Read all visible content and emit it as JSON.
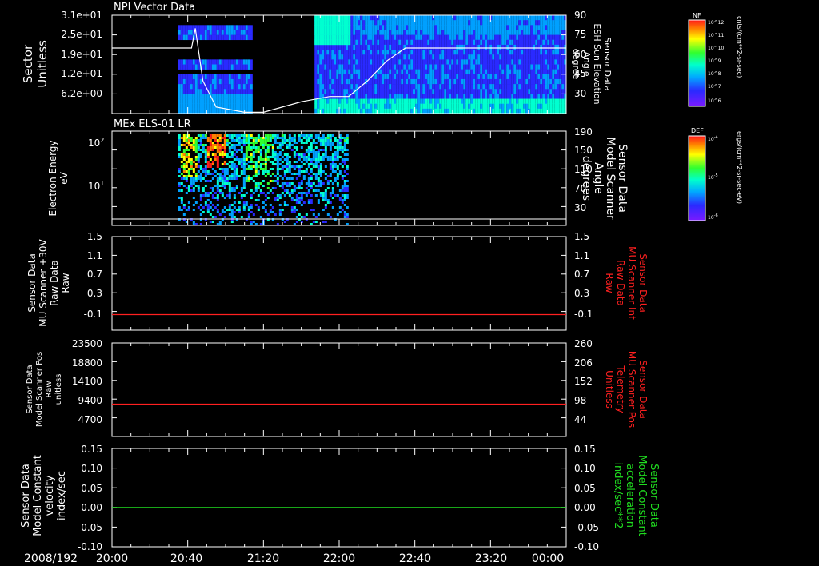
{
  "chart_data": [
    {
      "type": "heatmap",
      "title": "NPI Vector Data",
      "ylabel_left": [
        "Sector",
        "Unitless"
      ],
      "y_ticks_left": [
        "3.1e+01",
        "2.5e+01",
        "1.9e+01",
        "1.2e+01",
        "6.2e+00"
      ],
      "ylabel_right": [
        "Sensor Data",
        "ESH Sun Elevation",
        "Angle",
        "degree"
      ],
      "y_ticks_right": [
        "90",
        "75",
        "60",
        "45",
        "30"
      ],
      "colorbar": {
        "label": "NF",
        "unit": "cnts/(cm**2-sr-sec)",
        "ticks": [
          "10^12",
          "10^11",
          "10^10",
          "10^9",
          "10^8",
          "10^7",
          "10^6"
        ]
      },
      "overlay_line": {
        "name": "ESH Sun Elevation Angle",
        "x": [
          "20:00",
          "20:35",
          "20:42",
          "20:44",
          "20:48",
          "20:55",
          "21:10",
          "21:20",
          "21:40",
          "21:55",
          "22:05",
          "22:15",
          "22:25",
          "22:35",
          "24:00"
        ],
        "y": [
          65,
          65,
          65,
          80,
          40,
          20,
          16,
          16,
          24,
          28,
          28,
          40,
          55,
          65,
          65
        ]
      }
    },
    {
      "type": "heatmap",
      "title": "MEx ELS-01 LR",
      "ylabel_left": [
        "Electron Energy",
        "eV"
      ],
      "y_ticks_left": [
        "10^2",
        "10^1"
      ],
      "ylabel_right": [
        "Sensor Data",
        "Model Scanner",
        "Angle",
        "degrees"
      ],
      "y_ticks_right": [
        "190",
        "150",
        "110",
        "70",
        "30"
      ],
      "colorbar": {
        "label": "DEF",
        "unit": "ergs/(cm**2-sr-sec-eV)",
        "ticks": [
          "10^-4",
          "10^-5",
          "10^-6"
        ]
      },
      "overlay_line": {
        "name": "Model Scanner Angle",
        "x": [
          "20:00",
          "24:00"
        ],
        "y": [
          10,
          10
        ]
      }
    },
    {
      "type": "line",
      "ylabel_left": [
        "Sensor Data",
        "MU Scanner +30V",
        "Raw Data",
        "Raw"
      ],
      "y_ticks_left": [
        "1.5",
        "1.1",
        "0.7",
        "0.3",
        "-0.1"
      ],
      "ylim": [
        -0.3,
        1.5
      ],
      "ylabel_right": [
        "Sensor Data",
        "MU Scanner Int",
        "Raw Data",
        "Raw"
      ],
      "y_ticks_right": [
        "1.5",
        "1.1",
        "0.7",
        "0.3",
        "-0.1"
      ],
      "series": [
        {
          "name": "MU Scanner Int Raw Data",
          "x": [
            "20:00",
            "24:00"
          ],
          "y": [
            0.0,
            0.0
          ],
          "color": "#ff2020"
        }
      ]
    },
    {
      "type": "line",
      "ylabel_left": [
        "Sensor Data",
        "Model Scanner Pos",
        "Raw",
        "unitless"
      ],
      "y_ticks_left": [
        "23500",
        "18800",
        "14100",
        "9400",
        "4700"
      ],
      "ylim": [
        0,
        23500
      ],
      "ylabel_right": [
        "Sensor Data",
        "MU Scanner Pos",
        "Telemetry",
        "Unitless"
      ],
      "y_ticks_right": [
        "260",
        "206",
        "152",
        "98",
        "44"
      ],
      "series": [
        {
          "name": "MU Scanner Pos Telemetry",
          "x": [
            "20:00",
            "24:00"
          ],
          "y": [
            8150,
            8150
          ],
          "color": "#ff2020"
        }
      ]
    },
    {
      "type": "line",
      "ylabel_left": [
        "Sensor Data",
        "Model Constant",
        "velocity",
        "index/sec"
      ],
      "y_ticks_left": [
        "0.15",
        "0.10",
        "0.05",
        "0.00",
        "-0.05",
        "-0.10"
      ],
      "ylim": [
        -0.1,
        0.15
      ],
      "ylabel_right": [
        "Sensor Data",
        "Model Constant",
        "acceleration",
        "index/sec**2"
      ],
      "y_ticks_right": [
        "0.15",
        "0.10",
        "0.05",
        "0.00",
        "-0.05",
        "-0.10"
      ],
      "series": [
        {
          "name": "Model Constant acceleration",
          "x": [
            "20:00",
            "24:00"
          ],
          "y": [
            0.0,
            0.0
          ],
          "color": "#20dd20"
        }
      ]
    }
  ],
  "x_axis": {
    "date_label": "2008/192",
    "ticks": [
      "20:00",
      "20:40",
      "21:20",
      "22:00",
      "22:40",
      "23:20",
      "00:00"
    ]
  },
  "colors": {
    "background": "#000000",
    "axis": "#ffffff",
    "red_series": "#ff2020",
    "green_series": "#20dd20",
    "white_overlay": "#ffffff"
  }
}
